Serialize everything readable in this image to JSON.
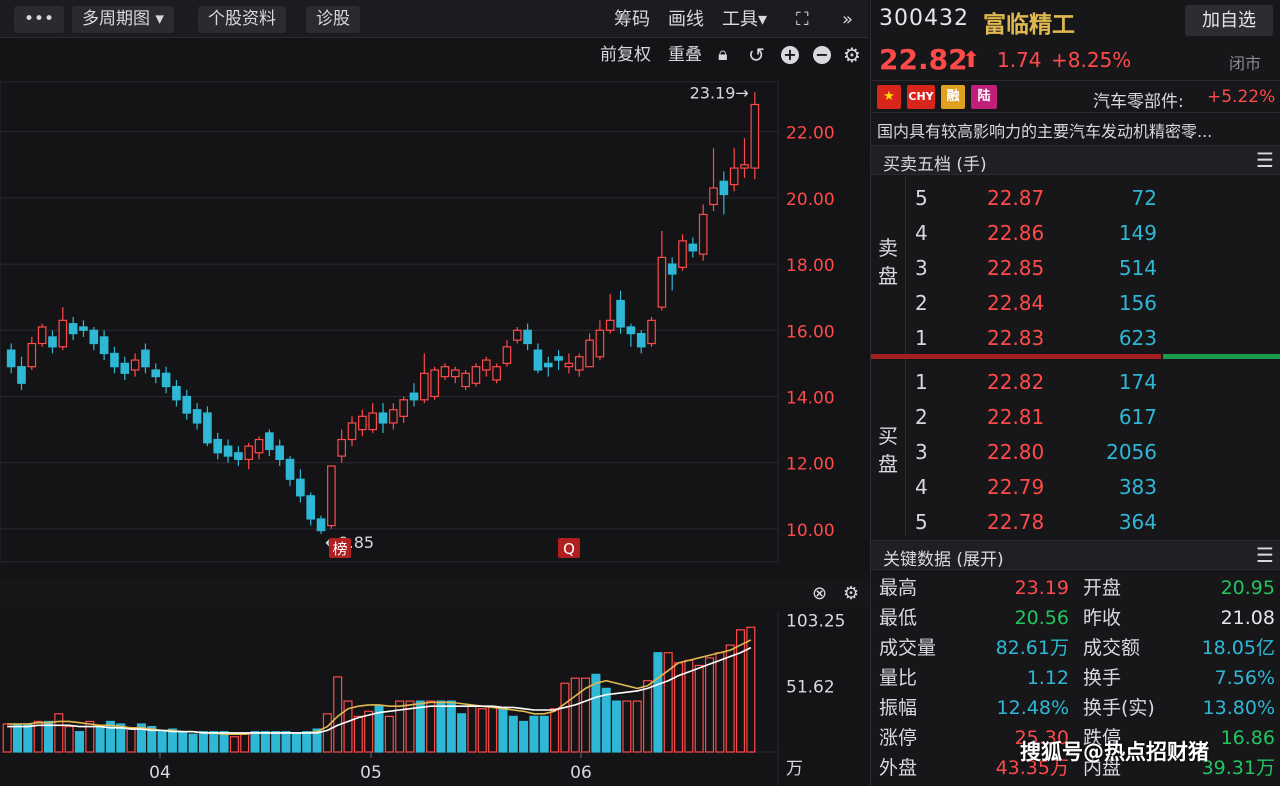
{
  "toolbar": {
    "more_label": "•••",
    "period_label": "多周期图",
    "profile_label": "个股资料",
    "diagnose_label": "诊股",
    "chips_label": "筹码",
    "draw_label": "画线",
    "tools_label": "工具",
    "collapse_label": "»"
  },
  "subtoolbar": {
    "adjust_label": "前复权",
    "overlay_label": "重叠"
  },
  "colors": {
    "up": "#ff4a4a",
    "down": "#2fb7d6",
    "ma_short": "#e0b850",
    "ma_long": "#ffffff",
    "grid": "#2a2a30"
  },
  "chart_data": [
    {
      "type": "candlestick",
      "title": "",
      "ylim": [
        9.0,
        23.5
      ],
      "y_ticks": [
        "22.00",
        "20.00",
        "18.00",
        "16.00",
        "14.00",
        "12.00",
        "10.00"
      ],
      "x_ticks": [
        "04",
        "05",
        "06"
      ],
      "high_label": "23.19→",
      "low_label": "←9.85",
      "marker_labels": [
        "榜",
        "Q"
      ],
      "candles": [
        {
          "o": 15.4,
          "c": 14.9,
          "h": 15.6,
          "l": 14.7
        },
        {
          "o": 14.9,
          "c": 14.4,
          "h": 15.2,
          "l": 14.2
        },
        {
          "o": 14.9,
          "c": 15.6,
          "h": 15.8,
          "l": 14.8
        },
        {
          "o": 15.6,
          "c": 16.1,
          "h": 16.2,
          "l": 15.5
        },
        {
          "o": 15.8,
          "c": 15.5,
          "h": 16.0,
          "l": 15.3
        },
        {
          "o": 15.5,
          "c": 16.3,
          "h": 16.7,
          "l": 15.4
        },
        {
          "o": 16.2,
          "c": 15.9,
          "h": 16.4,
          "l": 15.7
        },
        {
          "o": 16.1,
          "c": 16.0,
          "h": 16.3,
          "l": 15.8
        },
        {
          "o": 16.0,
          "c": 15.6,
          "h": 16.1,
          "l": 15.4
        },
        {
          "o": 15.8,
          "c": 15.3,
          "h": 16.0,
          "l": 15.1
        },
        {
          "o": 15.3,
          "c": 14.9,
          "h": 15.5,
          "l": 14.7
        },
        {
          "o": 15.0,
          "c": 14.7,
          "h": 15.2,
          "l": 14.5
        },
        {
          "o": 14.8,
          "c": 15.1,
          "h": 15.3,
          "l": 14.6
        },
        {
          "o": 15.4,
          "c": 14.9,
          "h": 15.6,
          "l": 14.7
        },
        {
          "o": 14.8,
          "c": 14.6,
          "h": 15.0,
          "l": 14.4
        },
        {
          "o": 14.7,
          "c": 14.3,
          "h": 14.9,
          "l": 14.1
        },
        {
          "o": 14.3,
          "c": 13.9,
          "h": 14.5,
          "l": 13.7
        },
        {
          "o": 14.0,
          "c": 13.5,
          "h": 14.2,
          "l": 13.3
        },
        {
          "o": 13.6,
          "c": 13.2,
          "h": 13.8,
          "l": 13.0
        },
        {
          "o": 13.5,
          "c": 12.6,
          "h": 13.7,
          "l": 12.5
        },
        {
          "o": 12.7,
          "c": 12.3,
          "h": 12.9,
          "l": 12.1
        },
        {
          "o": 12.5,
          "c": 12.2,
          "h": 12.7,
          "l": 12.0
        },
        {
          "o": 12.3,
          "c": 12.1,
          "h": 12.5,
          "l": 11.9
        },
        {
          "o": 12.1,
          "c": 12.5,
          "h": 12.6,
          "l": 11.8
        },
        {
          "o": 12.3,
          "c": 12.7,
          "h": 12.8,
          "l": 12.1
        },
        {
          "o": 12.9,
          "c": 12.4,
          "h": 13.0,
          "l": 12.2
        },
        {
          "o": 12.5,
          "c": 12.1,
          "h": 12.7,
          "l": 11.9
        },
        {
          "o": 12.1,
          "c": 11.5,
          "h": 12.2,
          "l": 11.3
        },
        {
          "o": 11.5,
          "c": 11.0,
          "h": 11.8,
          "l": 10.8
        },
        {
          "o": 11.0,
          "c": 10.3,
          "h": 11.1,
          "l": 10.1
        },
        {
          "o": 10.3,
          "c": 9.95,
          "h": 10.4,
          "l": 9.85
        },
        {
          "o": 10.1,
          "c": 11.9,
          "h": 11.9,
          "l": 10.0
        },
        {
          "o": 12.2,
          "c": 12.7,
          "h": 13.0,
          "l": 12.0
        },
        {
          "o": 12.7,
          "c": 13.2,
          "h": 13.4,
          "l": 12.5
        },
        {
          "o": 13.0,
          "c": 13.4,
          "h": 13.6,
          "l": 12.8
        },
        {
          "o": 13.0,
          "c": 13.5,
          "h": 13.8,
          "l": 12.9
        },
        {
          "o": 13.5,
          "c": 13.2,
          "h": 13.8,
          "l": 12.9
        },
        {
          "o": 13.2,
          "c": 13.6,
          "h": 13.8,
          "l": 13.0
        },
        {
          "o": 13.4,
          "c": 13.9,
          "h": 14.0,
          "l": 13.2
        },
        {
          "o": 14.1,
          "c": 13.9,
          "h": 14.4,
          "l": 13.7
        },
        {
          "o": 13.9,
          "c": 14.7,
          "h": 15.3,
          "l": 13.8
        },
        {
          "o": 14.0,
          "c": 14.8,
          "h": 14.9,
          "l": 13.9
        },
        {
          "o": 14.6,
          "c": 14.9,
          "h": 15.0,
          "l": 14.5
        },
        {
          "o": 14.6,
          "c": 14.8,
          "h": 14.9,
          "l": 14.4
        },
        {
          "o": 14.3,
          "c": 14.7,
          "h": 14.8,
          "l": 14.2
        },
        {
          "o": 14.4,
          "c": 14.9,
          "h": 15.0,
          "l": 14.3
        },
        {
          "o": 14.8,
          "c": 15.1,
          "h": 15.2,
          "l": 14.6
        },
        {
          "o": 14.5,
          "c": 14.9,
          "h": 15.0,
          "l": 14.4
        },
        {
          "o": 15.0,
          "c": 15.5,
          "h": 15.7,
          "l": 14.9
        },
        {
          "o": 15.7,
          "c": 16.0,
          "h": 16.1,
          "l": 15.6
        },
        {
          "o": 16.0,
          "c": 15.6,
          "h": 16.2,
          "l": 15.4
        },
        {
          "o": 15.4,
          "c": 14.8,
          "h": 15.6,
          "l": 14.7
        },
        {
          "o": 15.0,
          "c": 14.9,
          "h": 15.2,
          "l": 14.6
        },
        {
          "o": 15.2,
          "c": 15.1,
          "h": 15.4,
          "l": 14.8
        },
        {
          "o": 14.9,
          "c": 15.0,
          "h": 15.3,
          "l": 14.7
        },
        {
          "o": 14.8,
          "c": 15.2,
          "h": 15.3,
          "l": 14.6
        },
        {
          "o": 14.9,
          "c": 15.7,
          "h": 15.9,
          "l": 14.9
        },
        {
          "o": 15.2,
          "c": 16.0,
          "h": 16.3,
          "l": 15.1
        },
        {
          "o": 16.0,
          "c": 16.3,
          "h": 17.1,
          "l": 15.9
        },
        {
          "o": 16.9,
          "c": 16.1,
          "h": 17.2,
          "l": 15.9
        },
        {
          "o": 16.1,
          "c": 15.9,
          "h": 16.2,
          "l": 15.5
        },
        {
          "o": 15.9,
          "c": 15.5,
          "h": 16.0,
          "l": 15.3
        },
        {
          "o": 15.6,
          "c": 16.3,
          "h": 16.4,
          "l": 15.5
        },
        {
          "o": 16.7,
          "c": 18.2,
          "h": 19.0,
          "l": 16.6
        },
        {
          "o": 18.0,
          "c": 17.7,
          "h": 18.2,
          "l": 17.2
        },
        {
          "o": 17.9,
          "c": 18.7,
          "h": 18.9,
          "l": 17.8
        },
        {
          "o": 18.6,
          "c": 18.4,
          "h": 18.8,
          "l": 18.2
        },
        {
          "o": 18.3,
          "c": 19.5,
          "h": 19.8,
          "l": 18.1
        },
        {
          "o": 19.8,
          "c": 20.3,
          "h": 21.5,
          "l": 19.6
        },
        {
          "o": 20.5,
          "c": 20.1,
          "h": 20.8,
          "l": 19.5
        },
        {
          "o": 20.4,
          "c": 20.9,
          "h": 21.5,
          "l": 20.2
        },
        {
          "o": 20.9,
          "c": 21.0,
          "h": 21.8,
          "l": 20.6
        },
        {
          "o": 20.9,
          "c": 22.82,
          "h": 23.19,
          "l": 20.56
        }
      ]
    },
    {
      "type": "bar",
      "title": "",
      "unit_label": "万",
      "y_ticks": [
        "103.25",
        "51.62"
      ],
      "ylim": [
        0,
        110
      ],
      "values": [
        22,
        22,
        22,
        24,
        24,
        30,
        20,
        16,
        24,
        20,
        24,
        22,
        18,
        22,
        20,
        16,
        18,
        16,
        14,
        16,
        16,
        16,
        12,
        14,
        16,
        16,
        16,
        16,
        14,
        16,
        18,
        30,
        59,
        40,
        28,
        32,
        36,
        28,
        40,
        40,
        40,
        40,
        40,
        40,
        30,
        36,
        34,
        36,
        34,
        28,
        24,
        28,
        28,
        34,
        54,
        58,
        58,
        61,
        50,
        40,
        40,
        40,
        56,
        78,
        78,
        70,
        72,
        68,
        74,
        78,
        84,
        96,
        98
      ],
      "up": [
        1,
        0,
        0,
        1,
        0,
        1,
        1,
        0,
        1,
        0,
        0,
        0,
        1,
        0,
        0,
        0,
        0,
        0,
        0,
        0,
        0,
        0,
        1,
        1,
        0,
        0,
        0,
        0,
        0,
        0,
        0,
        1,
        1,
        1,
        1,
        1,
        0,
        1,
        1,
        1,
        0,
        1,
        0,
        0,
        0,
        1,
        1,
        1,
        0,
        0,
        0,
        0,
        0,
        1,
        1,
        1,
        1,
        0,
        0,
        0,
        1,
        1,
        1,
        0,
        1,
        1,
        1,
        1,
        1,
        1,
        1,
        1,
        1
      ],
      "ma_short": [
        22,
        22,
        22,
        23,
        23,
        24,
        24,
        23,
        22,
        21,
        21,
        20,
        19,
        19,
        18,
        17,
        17,
        16,
        16,
        15,
        15,
        14,
        14,
        14,
        15,
        15,
        15,
        15,
        15,
        15,
        16,
        20,
        28,
        34,
        36,
        37,
        37,
        36,
        36,
        37,
        38,
        39,
        39,
        39,
        38,
        37,
        36,
        35,
        34,
        33,
        32,
        30,
        30,
        32,
        38,
        44,
        50,
        54,
        56,
        54,
        52,
        50,
        52,
        58,
        64,
        70,
        72,
        74,
        76,
        78,
        80,
        84,
        88
      ],
      "ma_long": [
        20,
        20,
        20,
        21,
        21,
        21,
        21,
        20,
        20,
        20,
        19,
        19,
        18,
        18,
        17,
        17,
        16,
        16,
        16,
        15,
        15,
        15,
        15,
        15,
        15,
        15,
        15,
        15,
        15,
        15,
        15,
        17,
        21,
        24,
        27,
        29,
        31,
        32,
        33,
        34,
        35,
        36,
        36,
        36,
        36,
        36,
        36,
        36,
        35,
        35,
        34,
        33,
        33,
        33,
        35,
        37,
        40,
        43,
        45,
        46,
        47,
        48,
        50,
        53,
        56,
        60,
        63,
        66,
        69,
        72,
        75,
        78,
        82
      ]
    }
  ],
  "stock": {
    "code": "300432",
    "name": "富临精工",
    "add_fav_label": "加自选",
    "price": "22.82",
    "change": "1.74",
    "pct": "+8.25%",
    "status": "闭市",
    "badges": [
      "CHY",
      "融",
      "陆"
    ],
    "sector": "汽车零部件:",
    "sector_pct": "+5.22%",
    "description": "国内具有较高影响力的主要汽车发动机精密零..."
  },
  "orderbook": {
    "title": "买卖五档 (手)",
    "sell_label": "卖盘",
    "buy_label": "买盘",
    "asks": [
      {
        "lvl": "5",
        "price": "22.87",
        "vol": "72"
      },
      {
        "lvl": "4",
        "price": "22.86",
        "vol": "149"
      },
      {
        "lvl": "3",
        "price": "22.85",
        "vol": "514"
      },
      {
        "lvl": "2",
        "price": "22.84",
        "vol": "156"
      },
      {
        "lvl": "1",
        "price": "22.83",
        "vol": "623"
      }
    ],
    "bids": [
      {
        "lvl": "1",
        "price": "22.82",
        "vol": "174"
      },
      {
        "lvl": "2",
        "price": "22.81",
        "vol": "617"
      },
      {
        "lvl": "3",
        "price": "22.80",
        "vol": "2056"
      },
      {
        "lvl": "4",
        "price": "22.79",
        "vol": "383"
      },
      {
        "lvl": "5",
        "price": "22.78",
        "vol": "364"
      }
    ]
  },
  "keydata": {
    "title": "关键数据 (展开)",
    "rows": [
      [
        {
          "k": "最高",
          "v": "23.19",
          "c": "#ff4a4a"
        },
        {
          "k": "开盘",
          "v": "20.95",
          "c": "#22c55e"
        }
      ],
      [
        {
          "k": "最低",
          "v": "20.56",
          "c": "#22c55e"
        },
        {
          "k": "昨收",
          "v": "21.08",
          "c": "#e6e6ea"
        }
      ],
      [
        {
          "k": "成交量",
          "v": "82.61万",
          "c": "#2fb7d6"
        },
        {
          "k": "成交额",
          "v": "18.05亿",
          "c": "#2fb7d6"
        }
      ],
      [
        {
          "k": "量比",
          "v": "1.12",
          "c": "#2fb7d6"
        },
        {
          "k": "换手",
          "v": "7.56%",
          "c": "#2fb7d6"
        }
      ],
      [
        {
          "k": "振幅",
          "v": "12.48%",
          "c": "#2fb7d6"
        },
        {
          "k": "换手(实)",
          "v": "13.80%",
          "c": "#2fb7d6"
        }
      ],
      [
        {
          "k": "涨停",
          "v": "25.30",
          "c": "#ff4a4a"
        },
        {
          "k": "跌停",
          "v": "16.86",
          "c": "#22c55e"
        }
      ],
      [
        {
          "k": "外盘",
          "v": "43.35万",
          "c": "#ff4a4a"
        },
        {
          "k": "内盘",
          "v": "39.31万",
          "c": "#22c55e"
        }
      ]
    ]
  },
  "watermark": "搜狐号@热点招财猪"
}
